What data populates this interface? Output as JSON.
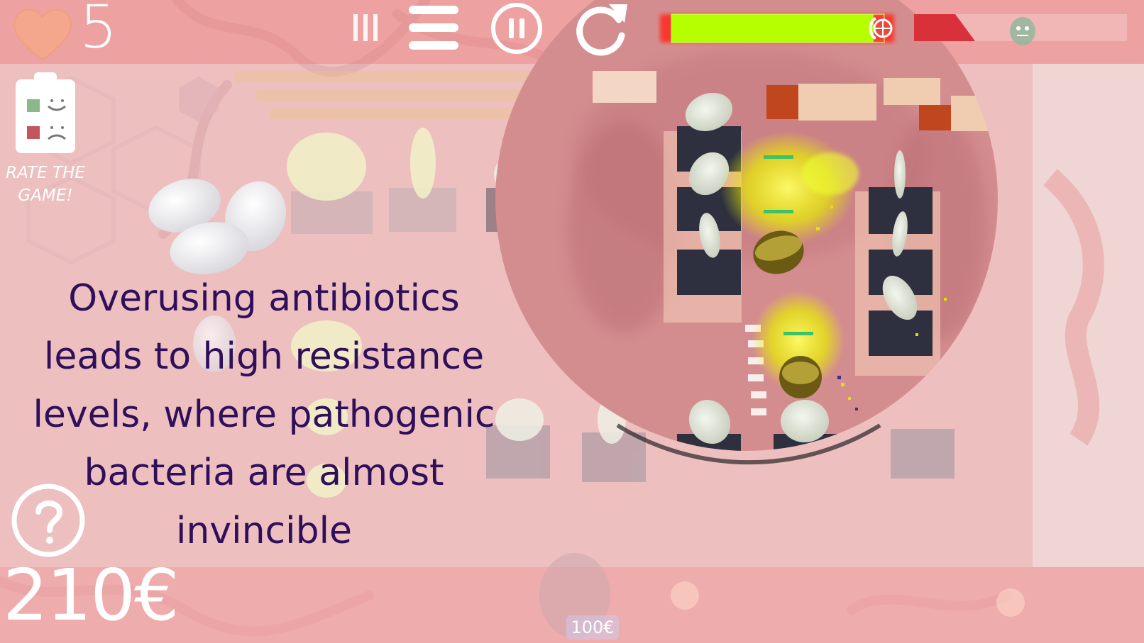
{
  "hud": {
    "lives": "5",
    "money": "210€",
    "rate_label": "RATE THE GAME!",
    "tower_price": "100€"
  },
  "wave": {
    "progress": 0.95
  },
  "tip": {
    "text": "Overusing antibiotics leads to high resistance levels, where pathogenic bacteria are almost invincible"
  },
  "colors": {
    "health_bar": "#b5ff00",
    "health_glow": "#ff2a1a",
    "tip_text": "#2f0f5a",
    "overlay": "#f6dede"
  },
  "icons": {
    "lives": "heart-icon",
    "speed": "speed-icon",
    "menu": "menu-icon",
    "pause": "pause-icon",
    "restart": "restart-icon",
    "help": "help-icon",
    "rate": "clipboard-icon",
    "enemy": "bacteria-icon"
  }
}
